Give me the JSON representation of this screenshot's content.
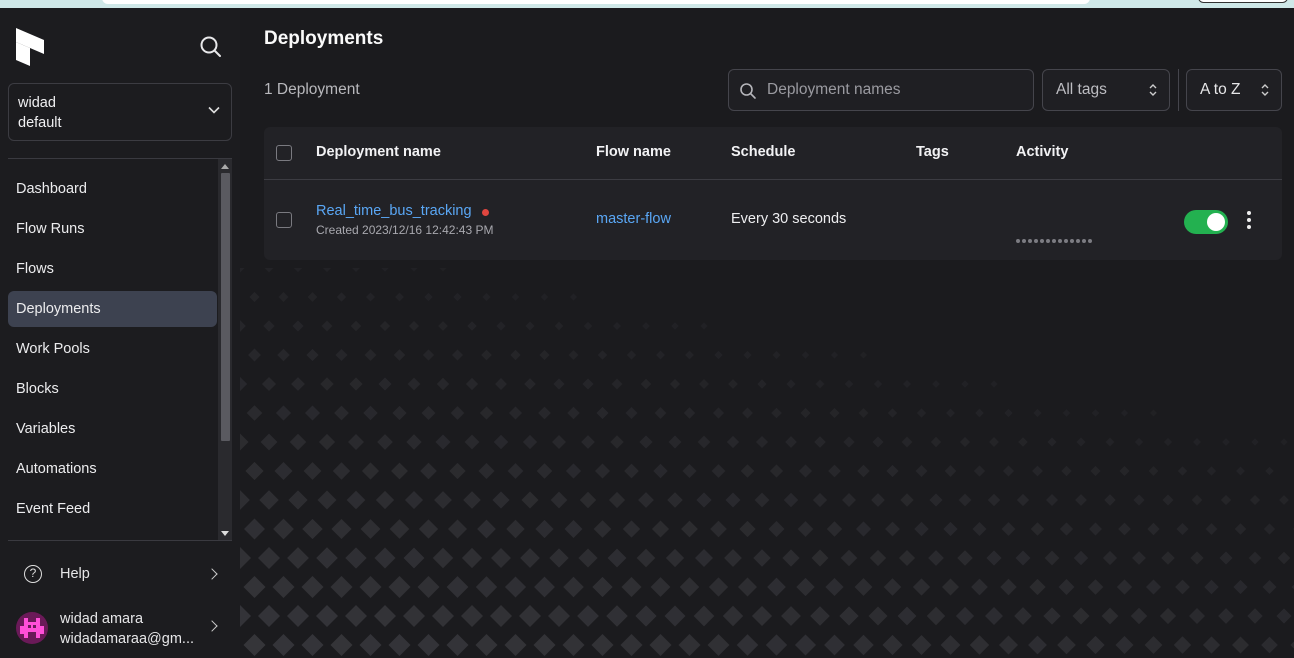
{
  "sidebar": {
    "workspace": {
      "account": "widad",
      "name": "default"
    },
    "nav": [
      {
        "label": "Dashboard",
        "active": false
      },
      {
        "label": "Flow Runs",
        "active": false
      },
      {
        "label": "Flows",
        "active": false
      },
      {
        "label": "Deployments",
        "active": true
      },
      {
        "label": "Work Pools",
        "active": false
      },
      {
        "label": "Blocks",
        "active": false
      },
      {
        "label": "Variables",
        "active": false
      },
      {
        "label": "Automations",
        "active": false
      },
      {
        "label": "Event Feed",
        "active": false
      }
    ],
    "help_label": "Help",
    "user": {
      "name": "widad amara",
      "email": "widadamaraa@gm..."
    }
  },
  "main": {
    "title": "Deployments",
    "count_label": "1 Deployment",
    "search": {
      "placeholder": "Deployment names",
      "value": ""
    },
    "tags_filter": "All tags",
    "sort": "A to Z",
    "table": {
      "columns": [
        "Deployment name",
        "Flow name",
        "Schedule",
        "Tags",
        "Activity"
      ],
      "rows": [
        {
          "deployment_name": "Real_time_bus_tracking",
          "created": "Created 2023/12/16 12:42:43 PM",
          "flow_name": "master-flow",
          "schedule": "Every 30 seconds",
          "tags": "",
          "status_color": "#e0463f",
          "enabled": true
        }
      ]
    }
  },
  "colors": {
    "accent_link": "#5aa7f5",
    "toggle_on": "#23b150",
    "active_nav_bg": "#3d4250",
    "background": "#1b1b1e"
  }
}
